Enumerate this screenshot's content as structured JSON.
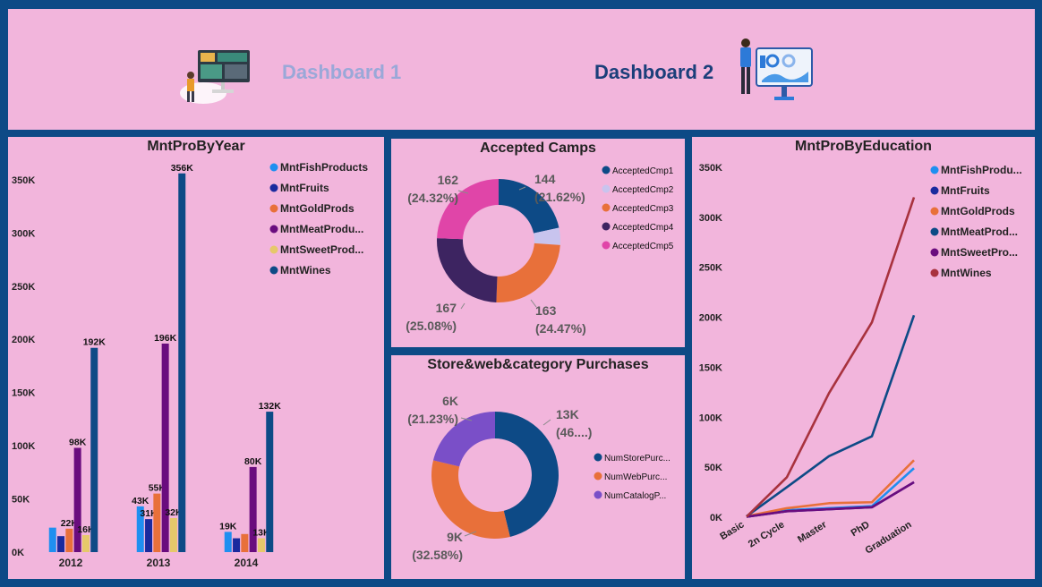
{
  "header": {
    "dashboard1_label": "Dashboard 1",
    "dashboard2_label": "Dashboard 2"
  },
  "colors": {
    "frame": "#0d4a86",
    "panel": "#f2b5dc",
    "fish": "#1f8ff0",
    "fruits": "#1a2a9e",
    "gold": "#e8703a",
    "meat": "#6a0c7e",
    "sweet": "#e6c86a",
    "wines": "#0d4a86",
    "wines_line": "#a8323e",
    "cmp2": "#c8c4ee",
    "cmp4": "#3d2461",
    "cmp5": "#e045a8",
    "catalog": "#7a4fc8"
  },
  "chart_data": [
    {
      "id": "year",
      "type": "bar",
      "title": "MntProByYear",
      "categories": [
        "2012",
        "2013",
        "2014"
      ],
      "ylim": [
        0,
        360000
      ],
      "yticks": [
        0,
        50000,
        100000,
        150000,
        200000,
        250000,
        300000,
        350000
      ],
      "ytick_labels": [
        "0K",
        "50K",
        "100K",
        "150K",
        "200K",
        "250K",
        "300K",
        "350K"
      ],
      "legend_position": "top-right",
      "series": [
        {
          "name": "MntFishProducts",
          "color_key": "fish",
          "values": [
            23000,
            43000,
            19000
          ],
          "labels": [
            "",
            "43K",
            "19K"
          ]
        },
        {
          "name": "MntFruits",
          "color_key": "fruits",
          "values": [
            15000,
            31000,
            13000
          ],
          "labels": [
            "",
            "31K",
            ""
          ]
        },
        {
          "name": "MntGoldProds",
          "color_key": "gold",
          "values": [
            22000,
            55000,
            17000
          ],
          "labels": [
            "22K",
            "55K",
            ""
          ]
        },
        {
          "name": "MntMeatProdu...",
          "color_key": "meat",
          "values": [
            98000,
            196000,
            80000
          ],
          "labels": [
            "98K",
            "196K",
            "80K"
          ]
        },
        {
          "name": "MntSweetProd...",
          "color_key": "sweet",
          "values": [
            16000,
            32000,
            13000
          ],
          "labels": [
            "16K",
            "32K",
            "13K"
          ]
        },
        {
          "name": "MntWines",
          "color_key": "wines",
          "values": [
            192000,
            356000,
            132000
          ],
          "labels": [
            "192K",
            "356K",
            "132K"
          ]
        }
      ]
    },
    {
      "id": "camps",
      "type": "pie",
      "title": "Accepted Camps",
      "legend_position": "right",
      "slices": [
        {
          "name": "AcceptedCmp1",
          "color_key": "wines",
          "value": 144,
          "label": "144",
          "pct": "(21.62%)"
        },
        {
          "name": "AcceptedCmp2",
          "color_key": "cmp2",
          "value": 30,
          "label": "",
          "pct": ""
        },
        {
          "name": "AcceptedCmp3",
          "color_key": "gold",
          "value": 163,
          "label": "163",
          "pct": "(24.47%)"
        },
        {
          "name": "AcceptedCmp4",
          "color_key": "cmp4",
          "value": 167,
          "label": "167",
          "pct": "(25.08%)"
        },
        {
          "name": "AcceptedCmp5",
          "color_key": "cmp5",
          "value": 162,
          "label": "162",
          "pct": "(24.32%)"
        }
      ]
    },
    {
      "id": "store",
      "type": "pie",
      "title": "Store&web&category Purchases",
      "legend_position": "right",
      "slices": [
        {
          "name": "NumStorePurc...",
          "color_key": "wines",
          "value": 46.19,
          "label": "13K",
          "pct": "(46....)"
        },
        {
          "name": "NumWebPurc...",
          "color_key": "gold",
          "value": 32.58,
          "label": "9K",
          "pct": "(32.58%)"
        },
        {
          "name": "NumCatalogP...",
          "color_key": "catalog",
          "value": 21.23,
          "label": "6K",
          "pct": "(21.23%)"
        }
      ]
    },
    {
      "id": "edu",
      "type": "line",
      "title": "MntProByEducation",
      "x": [
        "Basic",
        "2n Cycle",
        "Master",
        "PhD",
        "Graduation"
      ],
      "ylim": [
        0,
        350000
      ],
      "yticks": [
        0,
        50000,
        100000,
        150000,
        200000,
        250000,
        300000,
        350000
      ],
      "ytick_labels": [
        "0K",
        "50K",
        "100K",
        "150K",
        "200K",
        "250K",
        "300K",
        "350K"
      ],
      "legend_position": "top-right",
      "series": [
        {
          "name": "MntFishProdu...",
          "color_key": "fish",
          "values": [
            500,
            7000,
            9000,
            11000,
            49000
          ]
        },
        {
          "name": "MntFruits",
          "color_key": "fruits",
          "values": [
            500,
            6000,
            8000,
            10000,
            35000
          ]
        },
        {
          "name": "MntGoldProds",
          "color_key": "gold",
          "values": [
            1000,
            9000,
            14000,
            15000,
            57000
          ]
        },
        {
          "name": "MntMeatProd...",
          "color_key": "wines",
          "values": [
            1000,
            30000,
            61000,
            81000,
            202000
          ]
        },
        {
          "name": "MntSweetPro...",
          "color_key": "meat",
          "values": [
            500,
            6000,
            8000,
            10000,
            35000
          ]
        },
        {
          "name": "MntWines",
          "color_key": "wines_line",
          "values": [
            500,
            40000,
            124000,
            195000,
            320000
          ]
        }
      ]
    }
  ]
}
